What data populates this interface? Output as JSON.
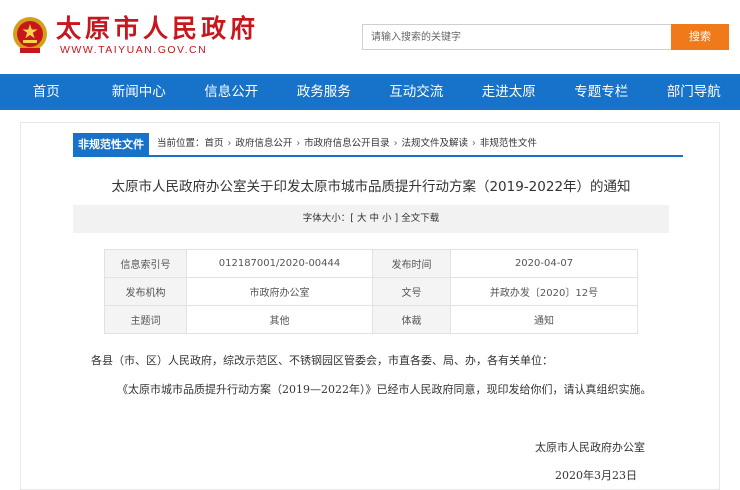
{
  "header": {
    "site_name": "太原市人民政府",
    "site_url": "WWW.TAIYUAN.GOV.CN",
    "search_placeholder": "请输入搜索的关键字",
    "search_button": "搜索"
  },
  "nav": [
    "首页",
    "新闻中心",
    "信息公开",
    "政务服务",
    "互动交流",
    "走进太原",
    "专题专栏",
    "部门导航"
  ],
  "breadcrumb": {
    "tab": "非规范性文件",
    "prefix": "当前位置：",
    "items": [
      "首页",
      "政府信息公开",
      "市政府信息公开目录",
      "法规文件及解读",
      "非规范性文件"
    ],
    "separator": "›"
  },
  "article": {
    "title": "太原市人民政府办公室关于印发太原市城市品质提升行动方案（2019-2022年）的通知",
    "font_size_bar": "字体大小：[ 大  中  小 ]  全文下载",
    "meta": {
      "index_label": "信息索引号",
      "index_value": "012187001/2020-00444",
      "date_label": "发布时间",
      "date_value": "2020-04-07",
      "org_label": "发布机构",
      "org_value": "市政府办公室",
      "docno_label": "文号",
      "docno_value": "并政办发〔2020〕12号",
      "topic_label": "主题词",
      "topic_value": "其他",
      "genre_label": "体裁",
      "genre_value": "通知"
    },
    "paragraph1": "各县（市、区）人民政府，综改示范区、不锈钢园区管委会，市直各委、局、办，各有关单位：",
    "paragraph2": "《太原市城市品质提升行动方案（2019—2022年）》已经市人民政府同意，现印发给你们，请认真组织实施。",
    "signature": "太原市人民政府办公室",
    "sign_date": "2020年3月23日"
  },
  "colors": {
    "brand_red": "#c8161d",
    "nav_blue": "#1772c9",
    "search_orange": "#f07a1a"
  }
}
